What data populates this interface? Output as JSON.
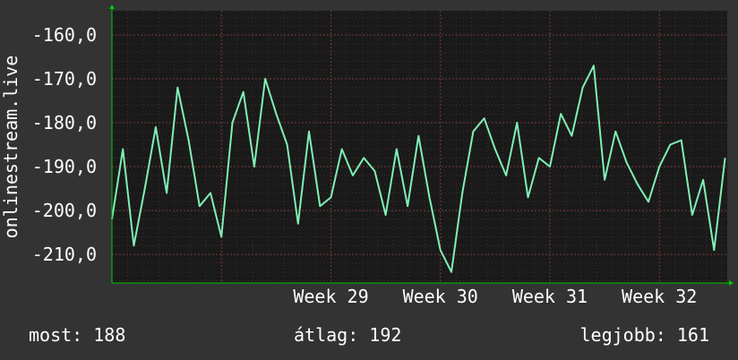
{
  "colors": {
    "background": "#333333",
    "plot_background": "#1a1a1a",
    "grid": "#7a3a3a",
    "line": "#7ff0b4",
    "axis": "#00c800",
    "text": "#ffffff"
  },
  "chart_data": {
    "type": "line",
    "ylabel": "onlinestream.live",
    "ylim": [
      -216.5,
      -154.5
    ],
    "yticks": [
      -160,
      -170,
      -180,
      -190,
      -200,
      -210
    ],
    "ytick_labels": [
      "-160,0",
      "-170,0",
      "-180,0",
      "-190,0",
      "-200,0",
      "-210,0"
    ],
    "xlim": [
      27.0,
      32.62
    ],
    "xticks": [
      29,
      30,
      31,
      32
    ],
    "xtick_labels": [
      "Week 29",
      "Week 30",
      "Week 31",
      "Week 32"
    ],
    "grid": true,
    "series": [
      {
        "x": [
          27.0,
          27.1,
          27.2,
          27.3,
          27.4,
          27.5,
          27.6,
          27.7,
          27.8,
          27.9,
          28.0,
          28.1,
          28.2,
          28.3,
          28.4,
          28.5,
          28.6,
          28.7,
          28.8,
          28.9,
          29.0,
          29.1,
          29.2,
          29.3,
          29.4,
          29.5,
          29.6,
          29.7,
          29.8,
          29.9,
          30.0,
          30.1,
          30.2,
          30.3,
          30.4,
          30.5,
          30.6,
          30.7,
          30.8,
          30.9,
          31.0,
          31.1,
          31.2,
          31.3,
          31.4,
          31.5,
          31.6,
          31.7,
          31.8,
          31.9,
          32.0,
          32.1,
          32.2,
          32.3,
          32.4,
          32.5,
          32.6
        ],
        "y": [
          -202,
          -186,
          -208,
          -195,
          -181,
          -196,
          -172,
          -184,
          -199,
          -196,
          -206,
          -180,
          -173,
          -190,
          -170,
          -178,
          -185,
          -203,
          -182,
          -199,
          -197,
          -186,
          -192,
          -188,
          -191,
          -201,
          -186,
          -199,
          -183,
          -197,
          -209,
          -214,
          -196,
          -182,
          -179,
          -186,
          -192,
          -180,
          -197,
          -188,
          -190,
          -178,
          -183,
          -172,
          -167,
          -193,
          -182,
          -189,
          -194,
          -198,
          -190,
          -185,
          -184,
          -201,
          -193,
          -209,
          -188
        ]
      }
    ]
  },
  "stats": {
    "now": "most: 188",
    "avg": "átlag: 192",
    "best": "legjobb: 161"
  }
}
